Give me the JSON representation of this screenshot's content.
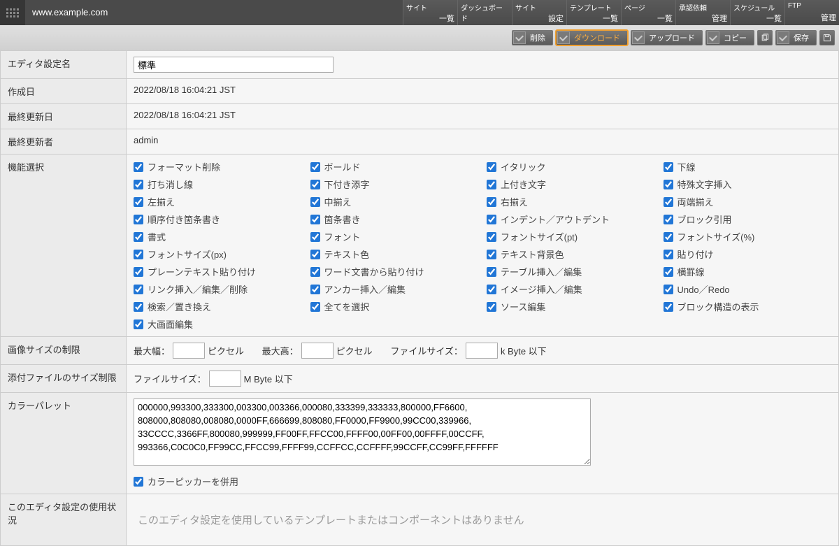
{
  "header": {
    "site_url": "www.example.com",
    "nav": [
      {
        "line1": "サイト",
        "line2": "一覧"
      },
      {
        "line1": "ダッシュボード",
        "line2": ""
      },
      {
        "line1": "サイト",
        "line2": "設定"
      },
      {
        "line1": "テンプレート",
        "line2": "一覧"
      },
      {
        "line1": "ページ",
        "line2": "一覧"
      },
      {
        "line1": "承認依頼",
        "line2": "管理"
      },
      {
        "line1": "スケジュール",
        "line2": "一覧"
      },
      {
        "line1": "FTP",
        "line2": "管理"
      }
    ]
  },
  "actions": {
    "delete": "削除",
    "download": "ダウンロード",
    "upload": "アップロード",
    "copy": "コピー",
    "save": "保存"
  },
  "fields": {
    "name_label": "エディタ設定名",
    "name_value": "標準",
    "created_label": "作成日",
    "created_value": "2022/08/18 16:04:21 JST",
    "updated_label": "最終更新日",
    "updated_value": "2022/08/18 16:04:21 JST",
    "updater_label": "最終更新者",
    "updater_value": "admin",
    "features_label": "機能選択",
    "imgsize_label": "画像サイズの制限",
    "maxw": "最大幅：",
    "px": "ピクセル",
    "maxh": "最大高：",
    "filesize": "ファイルサイズ：",
    "kbyte_suffix": "k Byte 以下",
    "attach_label": "添付ファイルのサイズ制限",
    "mbyte_suffix": "M Byte 以下",
    "palette_label": "カラーパレット",
    "palette_value": "000000,993300,333300,003300,003366,000080,333399,333333,800000,FF6600,\n808000,808080,008080,0000FF,666699,808080,FF0000,FF9900,99CC00,339966,\n33CCCC,3366FF,800080,999999,FF00FF,FFCC00,FFFF00,00FF00,00FFFF,00CCFF,\n993366,C0C0C0,FF99CC,FFCC99,FFFF99,CCFFCC,CCFFFF,99CCFF,CC99FF,FFFFFF",
    "picker_label": "カラーピッカーを併用",
    "usage_label": "このエディタ設定の使用状況",
    "usage_msg": "このエディタ設定を使用しているテンプレートまたはコンポーネントはありません"
  },
  "features": [
    "フォーマット削除",
    "ボールド",
    "イタリック",
    "下線",
    "打ち消し線",
    "下付き添字",
    "上付き文字",
    "特殊文字挿入",
    "左揃え",
    "中揃え",
    "右揃え",
    "両端揃え",
    "順序付き箇条書き",
    "箇条書き",
    "インデント／アウトデント",
    "ブロック引用",
    "書式",
    "フォント",
    "フォントサイズ(pt)",
    "フォントサイズ(%)",
    "フォントサイズ(px)",
    "テキスト色",
    "テキスト背景色",
    "貼り付け",
    "プレーンテキスト貼り付け",
    "ワード文書から貼り付け",
    "テーブル挿入／編集",
    "横罫線",
    "リンク挿入／編集／削除",
    "アンカー挿入／編集",
    "イメージ挿入／編集",
    "Undo／Redo",
    "検索／置き換え",
    "全てを選択",
    "ソース編集",
    "ブロック構造の表示",
    "大画面編集"
  ]
}
